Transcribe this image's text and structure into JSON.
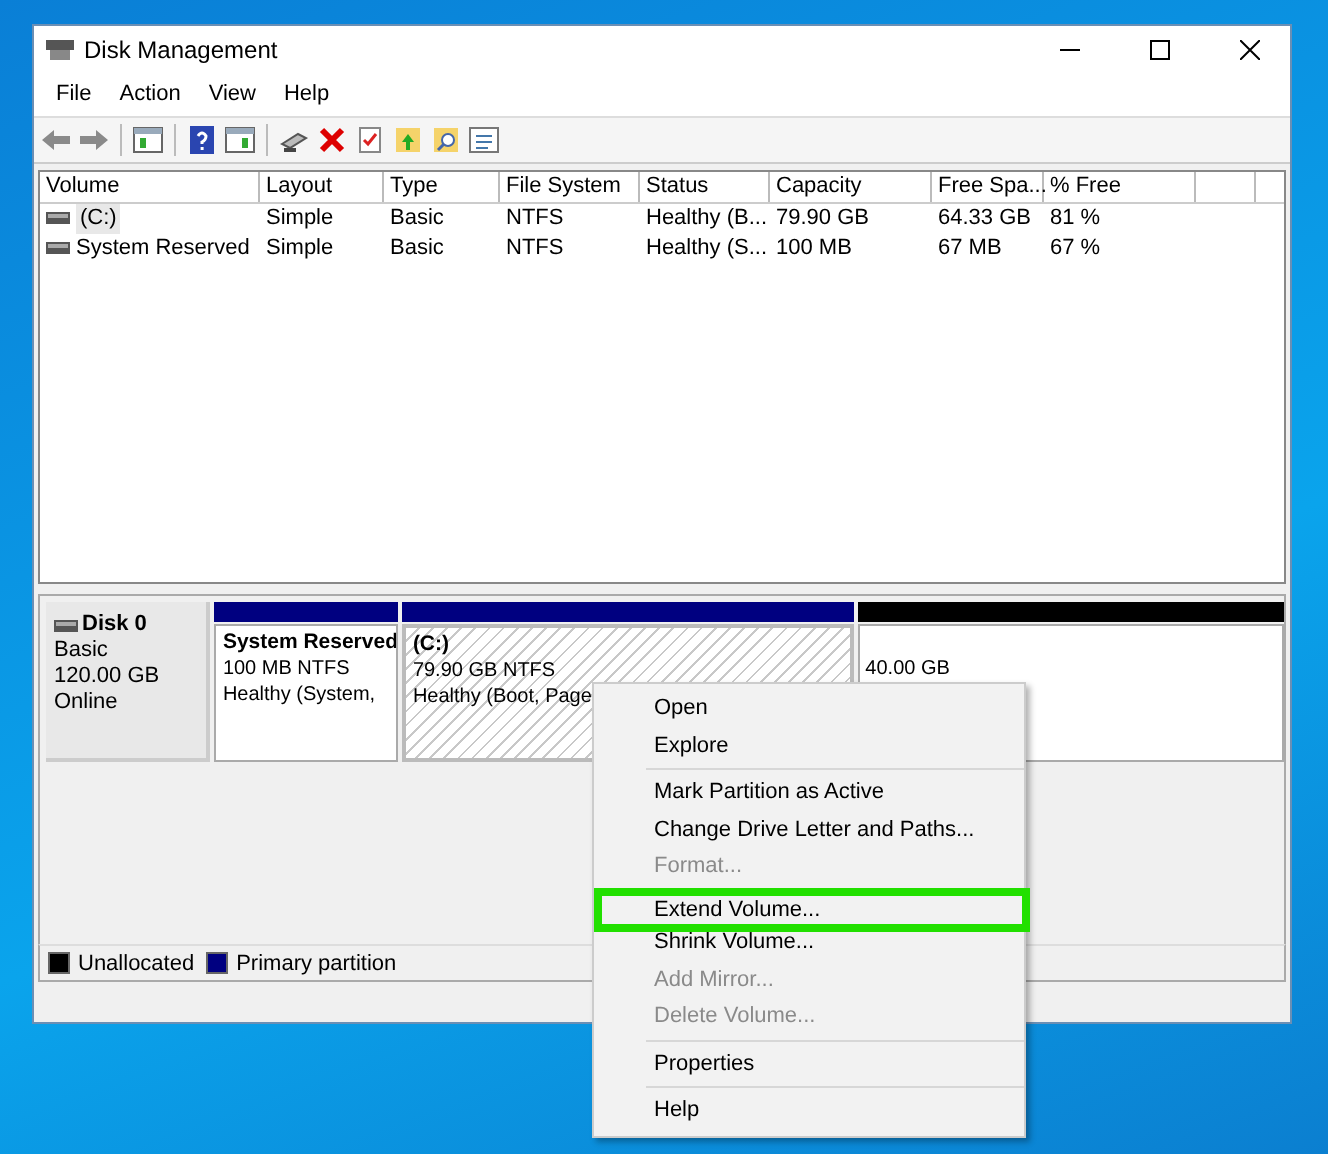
{
  "window": {
    "title": "Disk Management"
  },
  "menu": [
    "File",
    "Action",
    "View",
    "Help"
  ],
  "table": {
    "columns": [
      "Volume",
      "Layout",
      "Type",
      "File System",
      "Status",
      "Capacity",
      "Free Spa...",
      "% Free"
    ],
    "rows": [
      {
        "cells": [
          "(C:)",
          "Simple",
          "Basic",
          "NTFS",
          "Healthy (B...",
          "79.90 GB",
          "64.33 GB",
          "81 %"
        ],
        "selected": true
      },
      {
        "cells": [
          "System Reserved",
          "Simple",
          "Basic",
          "NTFS",
          "Healthy (S...",
          "100 MB",
          "67 MB",
          "67 %"
        ],
        "selected": false
      }
    ]
  },
  "disk": {
    "name": "Disk 0",
    "lines": [
      "Basic",
      "120.00 GB",
      "Online"
    ],
    "partitions": [
      {
        "kind": "primary",
        "title": "System Reserved",
        "lines": [
          "100 MB NTFS",
          "Healthy (System,"
        ],
        "selected": false
      },
      {
        "kind": "primary",
        "title": "(C:)",
        "lines": [
          "79.90 GB NTFS",
          "Healthy (Boot, Page"
        ],
        "selected": true
      },
      {
        "kind": "unallocated",
        "lines": [
          "40.00 GB"
        ],
        "selected": false
      }
    ]
  },
  "legend": [
    {
      "label": "Unallocated",
      "color": "#000000"
    },
    {
      "label": "Primary partition",
      "color": "#000080"
    }
  ],
  "context_menu": [
    {
      "kind": "item",
      "label": "Open",
      "disabled": false,
      "highlighted": false
    },
    {
      "kind": "item",
      "label": "Explore",
      "disabled": false,
      "highlighted": false
    },
    {
      "kind": "separator"
    },
    {
      "kind": "item",
      "label": "Mark Partition as Active",
      "disabled": false,
      "highlighted": false
    },
    {
      "kind": "item",
      "label": "Change Drive Letter and Paths...",
      "disabled": false,
      "highlighted": false
    },
    {
      "kind": "item",
      "label": "Format...",
      "disabled": true,
      "highlighted": false
    },
    {
      "kind": "separator"
    },
    {
      "kind": "item",
      "label": "Extend Volume...",
      "disabled": false,
      "highlighted": true
    },
    {
      "kind": "item",
      "label": "Shrink Volume...",
      "disabled": false,
      "highlighted": false
    },
    {
      "kind": "item",
      "label": "Add Mirror...",
      "disabled": true,
      "highlighted": false
    },
    {
      "kind": "item",
      "label": "Delete Volume...",
      "disabled": true,
      "highlighted": false
    },
    {
      "kind": "separator"
    },
    {
      "kind": "item",
      "label": "Properties",
      "disabled": false,
      "highlighted": false
    },
    {
      "kind": "separator"
    },
    {
      "kind": "item",
      "label": "Help",
      "disabled": false,
      "highlighted": false
    }
  ]
}
